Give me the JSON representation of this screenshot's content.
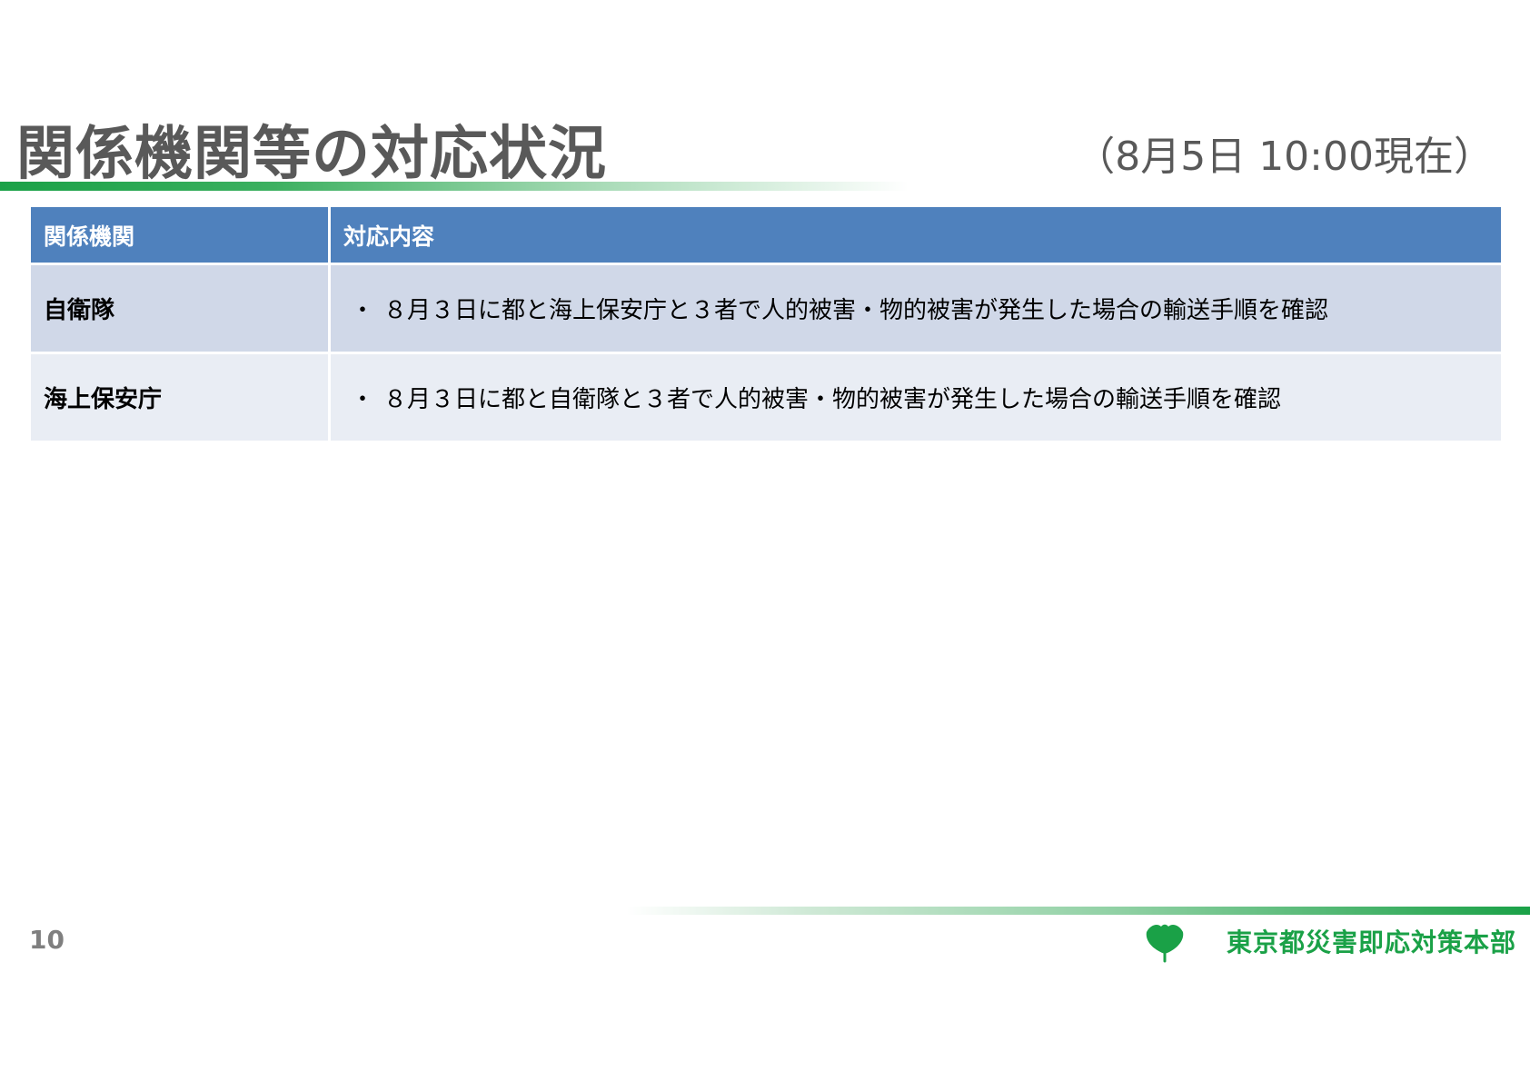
{
  "title": "関係機関等の対応状況",
  "as_of": "（8月5日 10:00現在）",
  "table": {
    "headers": [
      "関係機関",
      "対応内容"
    ],
    "rows": [
      {
        "org": "自衛隊",
        "bullet": "・",
        "content": "８月３日に都と海上保安庁と３者で人的被害・物的被害が発生した場合の輸送手順を確認"
      },
      {
        "org": "海上保安庁",
        "bullet": "・",
        "content": "８月３日に都と自衛隊と３者で人的被害・物的被害が発生した場合の輸送手順を確認"
      }
    ]
  },
  "footer": {
    "page_number": "10",
    "organization": "東京都災害即応対策本部",
    "logo_icon": "ginkgo-leaf-icon"
  },
  "colors": {
    "accent_green": "#1aa147",
    "header_blue": "#4f81bd",
    "row_odd": "#d0d8e8",
    "row_even": "#e9edf4",
    "title_gray": "#595959"
  }
}
